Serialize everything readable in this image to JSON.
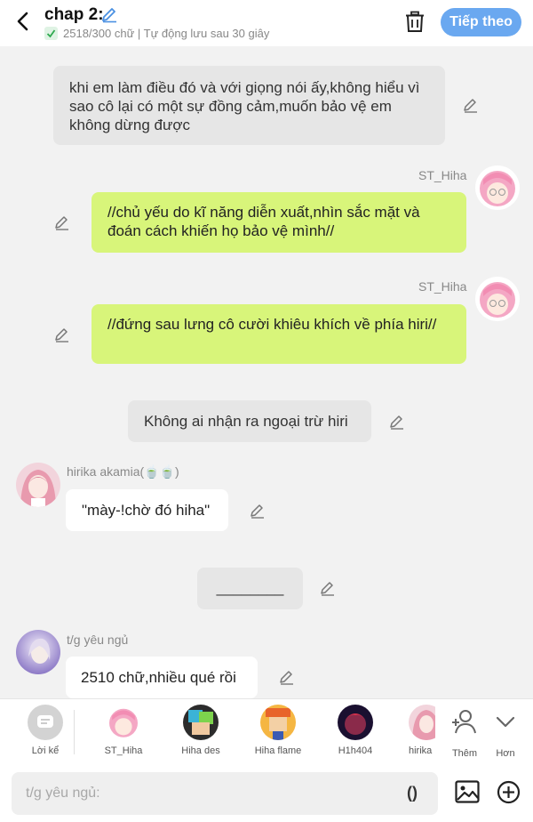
{
  "header": {
    "title": "chap 2:",
    "status": "2518/300 chữ | Tự động lưu sau 30 giây",
    "next_label": "Tiếp theo"
  },
  "messages": {
    "m1": "khi em làm điều đó và với giọng nói ấy,không hiểu vì sao cô lại có một sự đồng cảm,muốn bảo vệ em không dừng được",
    "m2_name": "ST_Hiha",
    "m2": "//chủ yếu do kĩ năng diễn xuất,nhìn sắc mặt và đoán cách khiến họ bảo vệ mình//",
    "m3_name": "ST_Hiha",
    "m3": "//đứng sau lưng cô cười khiêu khích về phía hiri//",
    "m4": "Không ai nhận ra ngoại trừ hiri",
    "m5_name": "hirika akamia(🍵🍵)",
    "m5": "\"mày-!chờ đó hiha\"",
    "m6": "________",
    "m7_name": "t/g yêu ngủ",
    "m7": "2510 chữ,nhiều qué rồi"
  },
  "characters": [
    {
      "label": "Lời kể",
      "icon": "narration-icon"
    },
    {
      "label": "ST_Hiha",
      "icon": "avatar"
    },
    {
      "label": "Hiha des",
      "icon": "avatar"
    },
    {
      "label": "Hiha flame",
      "icon": "avatar"
    },
    {
      "label": "H1h404",
      "icon": "avatar"
    },
    {
      "label": "hirika",
      "icon": "avatar"
    },
    {
      "label": "Thêm",
      "icon": "add-person-icon"
    },
    {
      "label": "Hơn",
      "icon": "chevron-down-icon"
    }
  ],
  "input": {
    "placeholder": "t/g yêu ngủ:",
    "paren_label": "()"
  },
  "colors": {
    "accent": "#6aa8f0",
    "green_bubble": "#d8f57a",
    "gray_bubble": "#e6e6e6",
    "background": "#f2f2f2"
  }
}
